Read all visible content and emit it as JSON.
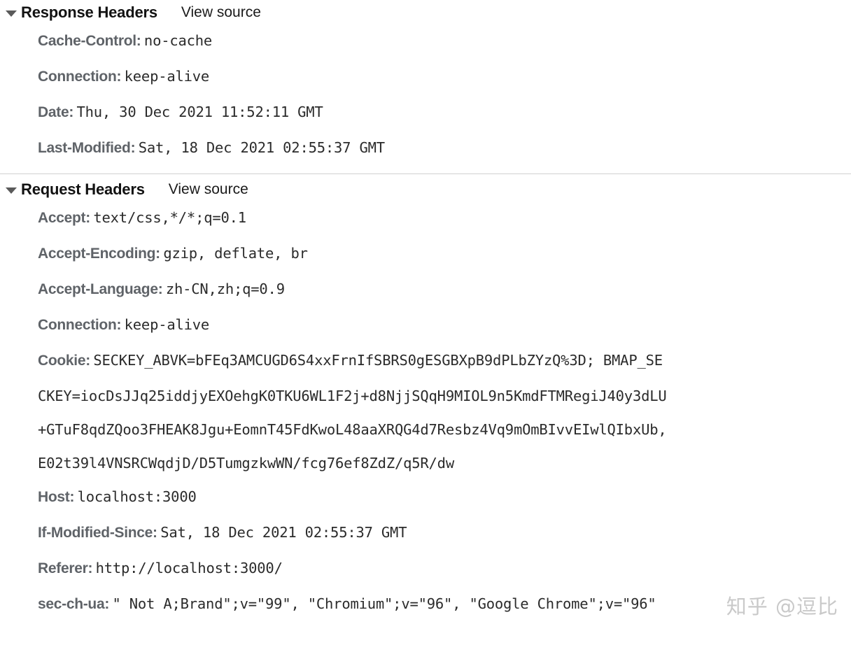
{
  "panel": {
    "twisty_icon": "triangle-down-icon",
    "view_source_label": "View source"
  },
  "response_headers": {
    "title": "Response Headers",
    "view_source_label": "View source",
    "items": [
      {
        "name": "Cache-Control:",
        "value": "no-cache"
      },
      {
        "name": "Connection:",
        "value": "keep-alive"
      },
      {
        "name": "Date:",
        "value": "Thu, 30 Dec 2021 11:52:11 GMT"
      },
      {
        "name": "Last-Modified:",
        "value": "Sat, 18 Dec 2021 02:55:37 GMT"
      }
    ]
  },
  "request_headers": {
    "title": "Request Headers",
    "view_source_label": "View source",
    "items": [
      {
        "name": "Accept:",
        "value": "text/css,*/*;q=0.1"
      },
      {
        "name": "Accept-Encoding:",
        "value": "gzip, deflate, br"
      },
      {
        "name": "Accept-Language:",
        "value": "zh-CN,zh;q=0.9"
      },
      {
        "name": "Connection:",
        "value": "keep-alive"
      }
    ],
    "cookie": {
      "name": "Cookie:",
      "lines": [
        "SECKEY_ABVK=bFEq3AMCUGD6S4xxFrnIfSBRS0gESGBXpB9dPLbZYzQ%3D; BMAP_SE",
        "CKEY=iocDsJJq25iddjyEXOehgK0TKU6WL1F2j+d8NjjSQqH9MIOL9n5KmdFTMRegiJ40y3dLU",
        "+GTuF8qdZQoo3FHEAK8Jgu+EomnT45FdKwoL48aaXRQG4d7Resbz4Vq9mOmBIvvEIwlQIbxUb,",
        "E02t39l4VNSRCWqdjD/D5TumgzkwWN/fcg76ef8ZdZ/q5R/dw"
      ]
    },
    "items_after_cookie": [
      {
        "name": "Host:",
        "value": "localhost:3000"
      },
      {
        "name": "If-Modified-Since:",
        "value": "Sat, 18 Dec 2021 02:55:37 GMT"
      },
      {
        "name": "Referer:",
        "value": "http://localhost:3000/"
      }
    ],
    "sec_ch_ua": {
      "name": "sec-ch-ua:",
      "value": "\" Not A;Brand\";v=\"99\", \"Chromium\";v=\"96\", \"Google Chrome\";v=\"96\""
    }
  },
  "watermark": {
    "text": "知乎 @逗比"
  },
  "colors": {
    "header_name": "#5f6368",
    "header_value": "#2b2b2b",
    "section_title": "#121212",
    "divider": "#d0d0d0",
    "background": "#ffffff"
  }
}
